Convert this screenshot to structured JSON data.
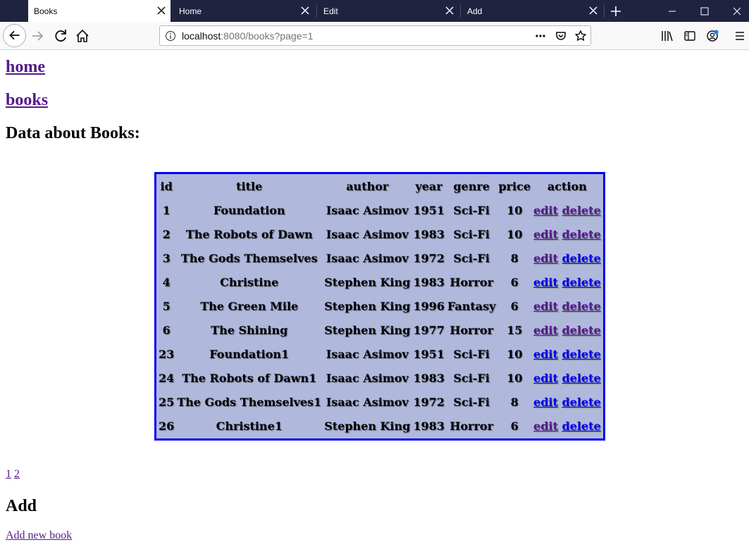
{
  "browser": {
    "tabs": [
      {
        "label": "Books",
        "active": true
      },
      {
        "label": "Home",
        "active": false
      },
      {
        "label": "Edit",
        "active": false
      },
      {
        "label": "Add",
        "active": false
      }
    ],
    "url": {
      "host": "localhost",
      "rest": ":8080/books?page=1"
    }
  },
  "page": {
    "home_link": "home",
    "books_link": "books",
    "heading": "Data about Books:",
    "table": {
      "headers": [
        "id",
        "title",
        "author",
        "year",
        "genre",
        "price",
        "action"
      ],
      "edit_label": "edit",
      "delete_label": "delete",
      "rows": [
        {
          "id": "1",
          "title": "Foundation",
          "author": "Isaac Asimov",
          "year": "1951",
          "genre": "Sci-Fi",
          "price": "10",
          "edit_visited": true,
          "delete_visited": true
        },
        {
          "id": "2",
          "title": "The Robots of Dawn",
          "author": "Isaac Asimov",
          "year": "1983",
          "genre": "Sci-Fi",
          "price": "10",
          "edit_visited": true,
          "delete_visited": true
        },
        {
          "id": "3",
          "title": "The Gods Themselves",
          "author": "Isaac Asimov",
          "year": "1972",
          "genre": "Sci-Fi",
          "price": "8",
          "edit_visited": true,
          "delete_visited": false
        },
        {
          "id": "4",
          "title": "Christine",
          "author": "Stephen King",
          "year": "1983",
          "genre": "Horror",
          "price": "6",
          "edit_visited": false,
          "delete_visited": false
        },
        {
          "id": "5",
          "title": "The Green Mile",
          "author": "Stephen King",
          "year": "1996",
          "genre": "Fantasy",
          "price": "6",
          "edit_visited": true,
          "delete_visited": true
        },
        {
          "id": "6",
          "title": "The Shining",
          "author": "Stephen King",
          "year": "1977",
          "genre": "Horror",
          "price": "15",
          "edit_visited": true,
          "delete_visited": true
        },
        {
          "id": "23",
          "title": "Foundation1",
          "author": "Isaac Asimov",
          "year": "1951",
          "genre": "Sci-Fi",
          "price": "10",
          "edit_visited": false,
          "delete_visited": false
        },
        {
          "id": "24",
          "title": "The Robots of Dawn1",
          "author": "Isaac Asimov",
          "year": "1983",
          "genre": "Sci-Fi",
          "price": "10",
          "edit_visited": false,
          "delete_visited": false
        },
        {
          "id": "25",
          "title": "The Gods Themselves1",
          "author": "Isaac Asimov",
          "year": "1972",
          "genre": "Sci-Fi",
          "price": "8",
          "edit_visited": false,
          "delete_visited": false
        },
        {
          "id": "26",
          "title": "Christine1",
          "author": "Stephen King",
          "year": "1983",
          "genre": "Horror",
          "price": "6",
          "edit_visited": true,
          "delete_visited": false
        }
      ]
    },
    "pages": [
      "1",
      "2"
    ],
    "add_heading": "Add",
    "add_link": "Add new book"
  },
  "colors": {
    "tabbar": "#202340",
    "table_bg": "#b0b9dc",
    "table_border": "#0000ee",
    "link_unvisited": "#0000ee",
    "link_visited": "#551a8b"
  },
  "icons": [
    "close-icon",
    "plus-icon",
    "minimize-icon",
    "maximize-icon",
    "back-arrow-icon",
    "forward-arrow-icon",
    "reload-icon",
    "home-icon",
    "info-icon",
    "more-icon",
    "pocket-icon",
    "star-icon",
    "library-icon",
    "sidebar-icon",
    "account-icon",
    "menu-icon"
  ]
}
